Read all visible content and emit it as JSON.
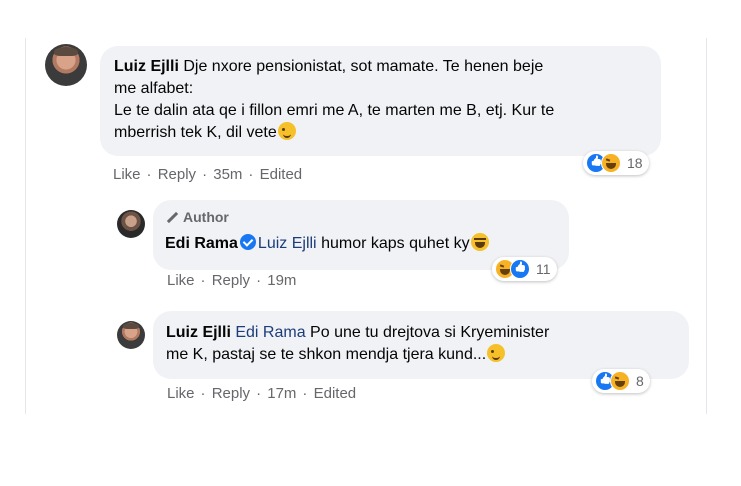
{
  "comments": [
    {
      "author": "Luiz Ejlli",
      "lines": [
        "Dje nxore pensionistat, sot mamate. Te henen beje",
        "me alfabet:",
        "Le te dalin ata qe i fillon emri me A, te marten me B, etj. Kur te",
        "mberrish tek K, dil vete"
      ],
      "trailing_emoji": "wink-emoji",
      "reaction_count": "18",
      "actions": {
        "like": "Like",
        "reply": "Reply",
        "time": "35m",
        "edited": "Edited"
      }
    },
    {
      "badge": "Author",
      "author": "Edi Rama",
      "mention": "Luiz Ejlli",
      "text": "humor kaps quhet ky",
      "trailing_emoji": "laughing-emoji",
      "reaction_count": "11",
      "actions": {
        "like": "Like",
        "reply": "Reply",
        "time": "19m"
      }
    },
    {
      "author": "Luiz Ejlli",
      "mention": "Edi Rama",
      "lines": [
        "Po une tu drejtova si Kryeminister",
        "me K, pastaj se te shkon mendja tjera kund..."
      ],
      "trailing_emoji": "wink-emoji",
      "reaction_count": "8",
      "actions": {
        "like": "Like",
        "reply": "Reply",
        "time": "17m",
        "edited": "Edited"
      }
    }
  ],
  "separator": "·",
  "colors": {
    "bubble": "#f0f2f5",
    "meta": "#65676b",
    "mention": "#1c3d7a",
    "like": "#1877f2",
    "haha": "#f7b125"
  }
}
